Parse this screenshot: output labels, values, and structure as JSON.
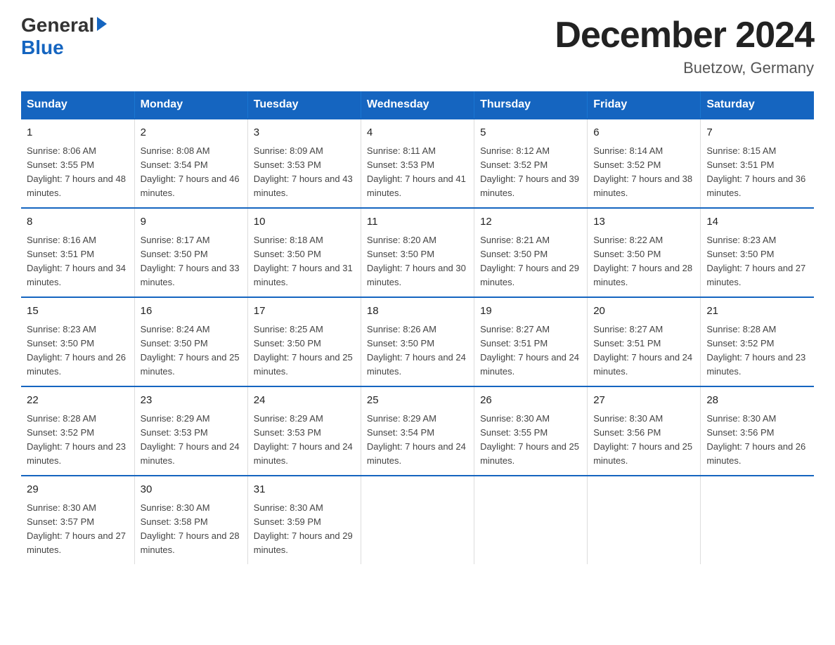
{
  "header": {
    "logo_general": "General",
    "logo_blue": "Blue",
    "month_title": "December 2024",
    "location": "Buetzow, Germany"
  },
  "weekdays": [
    "Sunday",
    "Monday",
    "Tuesday",
    "Wednesday",
    "Thursday",
    "Friday",
    "Saturday"
  ],
  "weeks": [
    [
      {
        "day": "1",
        "sunrise": "Sunrise: 8:06 AM",
        "sunset": "Sunset: 3:55 PM",
        "daylight": "Daylight: 7 hours and 48 minutes."
      },
      {
        "day": "2",
        "sunrise": "Sunrise: 8:08 AM",
        "sunset": "Sunset: 3:54 PM",
        "daylight": "Daylight: 7 hours and 46 minutes."
      },
      {
        "day": "3",
        "sunrise": "Sunrise: 8:09 AM",
        "sunset": "Sunset: 3:53 PM",
        "daylight": "Daylight: 7 hours and 43 minutes."
      },
      {
        "day": "4",
        "sunrise": "Sunrise: 8:11 AM",
        "sunset": "Sunset: 3:53 PM",
        "daylight": "Daylight: 7 hours and 41 minutes."
      },
      {
        "day": "5",
        "sunrise": "Sunrise: 8:12 AM",
        "sunset": "Sunset: 3:52 PM",
        "daylight": "Daylight: 7 hours and 39 minutes."
      },
      {
        "day": "6",
        "sunrise": "Sunrise: 8:14 AM",
        "sunset": "Sunset: 3:52 PM",
        "daylight": "Daylight: 7 hours and 38 minutes."
      },
      {
        "day": "7",
        "sunrise": "Sunrise: 8:15 AM",
        "sunset": "Sunset: 3:51 PM",
        "daylight": "Daylight: 7 hours and 36 minutes."
      }
    ],
    [
      {
        "day": "8",
        "sunrise": "Sunrise: 8:16 AM",
        "sunset": "Sunset: 3:51 PM",
        "daylight": "Daylight: 7 hours and 34 minutes."
      },
      {
        "day": "9",
        "sunrise": "Sunrise: 8:17 AM",
        "sunset": "Sunset: 3:50 PM",
        "daylight": "Daylight: 7 hours and 33 minutes."
      },
      {
        "day": "10",
        "sunrise": "Sunrise: 8:18 AM",
        "sunset": "Sunset: 3:50 PM",
        "daylight": "Daylight: 7 hours and 31 minutes."
      },
      {
        "day": "11",
        "sunrise": "Sunrise: 8:20 AM",
        "sunset": "Sunset: 3:50 PM",
        "daylight": "Daylight: 7 hours and 30 minutes."
      },
      {
        "day": "12",
        "sunrise": "Sunrise: 8:21 AM",
        "sunset": "Sunset: 3:50 PM",
        "daylight": "Daylight: 7 hours and 29 minutes."
      },
      {
        "day": "13",
        "sunrise": "Sunrise: 8:22 AM",
        "sunset": "Sunset: 3:50 PM",
        "daylight": "Daylight: 7 hours and 28 minutes."
      },
      {
        "day": "14",
        "sunrise": "Sunrise: 8:23 AM",
        "sunset": "Sunset: 3:50 PM",
        "daylight": "Daylight: 7 hours and 27 minutes."
      }
    ],
    [
      {
        "day": "15",
        "sunrise": "Sunrise: 8:23 AM",
        "sunset": "Sunset: 3:50 PM",
        "daylight": "Daylight: 7 hours and 26 minutes."
      },
      {
        "day": "16",
        "sunrise": "Sunrise: 8:24 AM",
        "sunset": "Sunset: 3:50 PM",
        "daylight": "Daylight: 7 hours and 25 minutes."
      },
      {
        "day": "17",
        "sunrise": "Sunrise: 8:25 AM",
        "sunset": "Sunset: 3:50 PM",
        "daylight": "Daylight: 7 hours and 25 minutes."
      },
      {
        "day": "18",
        "sunrise": "Sunrise: 8:26 AM",
        "sunset": "Sunset: 3:50 PM",
        "daylight": "Daylight: 7 hours and 24 minutes."
      },
      {
        "day": "19",
        "sunrise": "Sunrise: 8:27 AM",
        "sunset": "Sunset: 3:51 PM",
        "daylight": "Daylight: 7 hours and 24 minutes."
      },
      {
        "day": "20",
        "sunrise": "Sunrise: 8:27 AM",
        "sunset": "Sunset: 3:51 PM",
        "daylight": "Daylight: 7 hours and 24 minutes."
      },
      {
        "day": "21",
        "sunrise": "Sunrise: 8:28 AM",
        "sunset": "Sunset: 3:52 PM",
        "daylight": "Daylight: 7 hours and 23 minutes."
      }
    ],
    [
      {
        "day": "22",
        "sunrise": "Sunrise: 8:28 AM",
        "sunset": "Sunset: 3:52 PM",
        "daylight": "Daylight: 7 hours and 23 minutes."
      },
      {
        "day": "23",
        "sunrise": "Sunrise: 8:29 AM",
        "sunset": "Sunset: 3:53 PM",
        "daylight": "Daylight: 7 hours and 24 minutes."
      },
      {
        "day": "24",
        "sunrise": "Sunrise: 8:29 AM",
        "sunset": "Sunset: 3:53 PM",
        "daylight": "Daylight: 7 hours and 24 minutes."
      },
      {
        "day": "25",
        "sunrise": "Sunrise: 8:29 AM",
        "sunset": "Sunset: 3:54 PM",
        "daylight": "Daylight: 7 hours and 24 minutes."
      },
      {
        "day": "26",
        "sunrise": "Sunrise: 8:30 AM",
        "sunset": "Sunset: 3:55 PM",
        "daylight": "Daylight: 7 hours and 25 minutes."
      },
      {
        "day": "27",
        "sunrise": "Sunrise: 8:30 AM",
        "sunset": "Sunset: 3:56 PM",
        "daylight": "Daylight: 7 hours and 25 minutes."
      },
      {
        "day": "28",
        "sunrise": "Sunrise: 8:30 AM",
        "sunset": "Sunset: 3:56 PM",
        "daylight": "Daylight: 7 hours and 26 minutes."
      }
    ],
    [
      {
        "day": "29",
        "sunrise": "Sunrise: 8:30 AM",
        "sunset": "Sunset: 3:57 PM",
        "daylight": "Daylight: 7 hours and 27 minutes."
      },
      {
        "day": "30",
        "sunrise": "Sunrise: 8:30 AM",
        "sunset": "Sunset: 3:58 PM",
        "daylight": "Daylight: 7 hours and 28 minutes."
      },
      {
        "day": "31",
        "sunrise": "Sunrise: 8:30 AM",
        "sunset": "Sunset: 3:59 PM",
        "daylight": "Daylight: 7 hours and 29 minutes."
      },
      null,
      null,
      null,
      null
    ]
  ]
}
